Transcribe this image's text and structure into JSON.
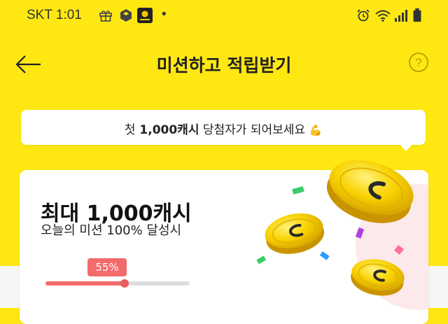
{
  "status_bar": {
    "carrier_time": "SKT 1:01",
    "dot": "•",
    "icons": [
      "gift-icon",
      "box-icon",
      "app-logo-icon",
      "alarm-icon",
      "wifi-icon",
      "signal-icon",
      "battery-icon"
    ]
  },
  "header": {
    "title": "미션하고 적립받기",
    "back_icon": "arrow-left-icon",
    "help_icon": "question-circle-icon"
  },
  "banner": {
    "text_prefix": "첫",
    "text_bold": " 1,000캐시",
    "text_suffix": " 당첨자가 되어보세요",
    "emoji": "💪"
  },
  "mission_card": {
    "title": "최대 1,000캐시",
    "subtitle": "오늘의 미션 100% 달성시",
    "progress_label": "55%",
    "progress_value": 0.55
  },
  "colors": {
    "background": "#FFE812",
    "accent": "#F26C6C",
    "coin": "#F2C400"
  }
}
